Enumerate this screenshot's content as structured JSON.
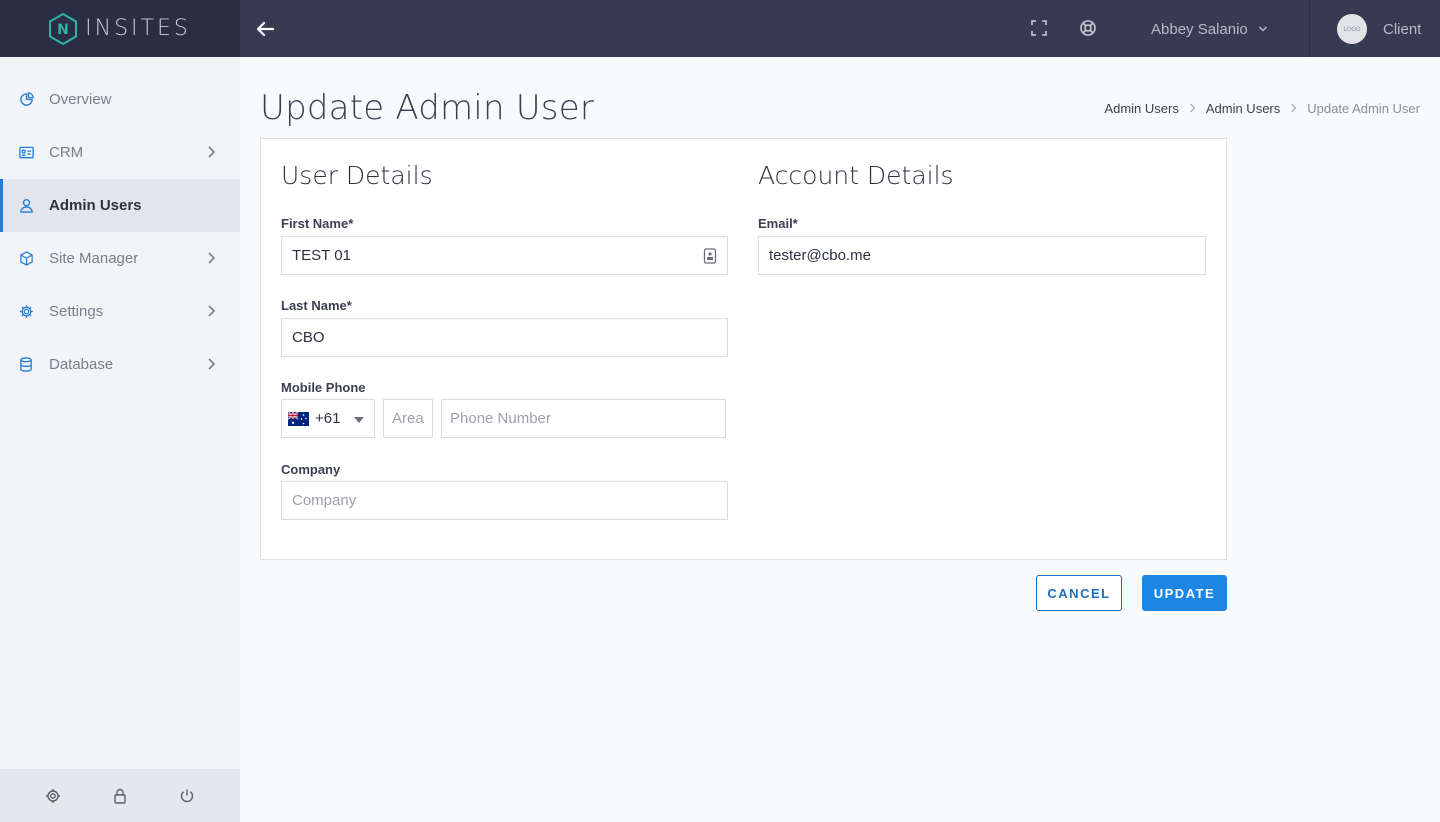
{
  "brand": {
    "name": "INSITES",
    "logo_letter": "N"
  },
  "topbar": {
    "user_name": "Abbey Salanio",
    "client_label": "Client",
    "client_logo_text": "LOGO"
  },
  "sidebar": {
    "items": [
      {
        "label": "Overview",
        "icon": "pie-chart-icon",
        "has_chevron": false,
        "active": false
      },
      {
        "label": "CRM",
        "icon": "id-card-icon",
        "has_chevron": true,
        "active": false
      },
      {
        "label": "Admin Users",
        "icon": "user-icon",
        "has_chevron": false,
        "active": true
      },
      {
        "label": "Site Manager",
        "icon": "cube-icon",
        "has_chevron": true,
        "active": false
      },
      {
        "label": "Settings",
        "icon": "gear-icon",
        "has_chevron": true,
        "active": false
      },
      {
        "label": "Database",
        "icon": "database-icon",
        "has_chevron": true,
        "active": false
      }
    ],
    "footer_icons": [
      "gear-icon",
      "lock-icon",
      "power-icon"
    ]
  },
  "page": {
    "title": "Update Admin User",
    "breadcrumb": [
      "Admin Users",
      "Admin Users",
      "Update Admin User"
    ]
  },
  "form": {
    "user_details_title": "User Details",
    "account_details_title": "Account Details",
    "first_name": {
      "label": "First Name*",
      "value": "TEST 01"
    },
    "last_name": {
      "label": "Last Name*",
      "value": "CBO"
    },
    "mobile_phone": {
      "label": "Mobile Phone",
      "country_code": "+61",
      "area_placeholder": "Area",
      "number_placeholder": "Phone Number"
    },
    "company": {
      "label": "Company",
      "placeholder": "Company"
    },
    "email": {
      "label": "Email*",
      "value": "tester@cbo.me"
    }
  },
  "actions": {
    "cancel_label": "CANCEL",
    "update_label": "UPDATE"
  },
  "colors": {
    "sidebar_bg": "#f3f4f7",
    "topbar_bg": "#363b52",
    "logo_bg": "#2a2e42",
    "accent": "#1c86e4",
    "active_indicator": "#1f7fd8"
  }
}
